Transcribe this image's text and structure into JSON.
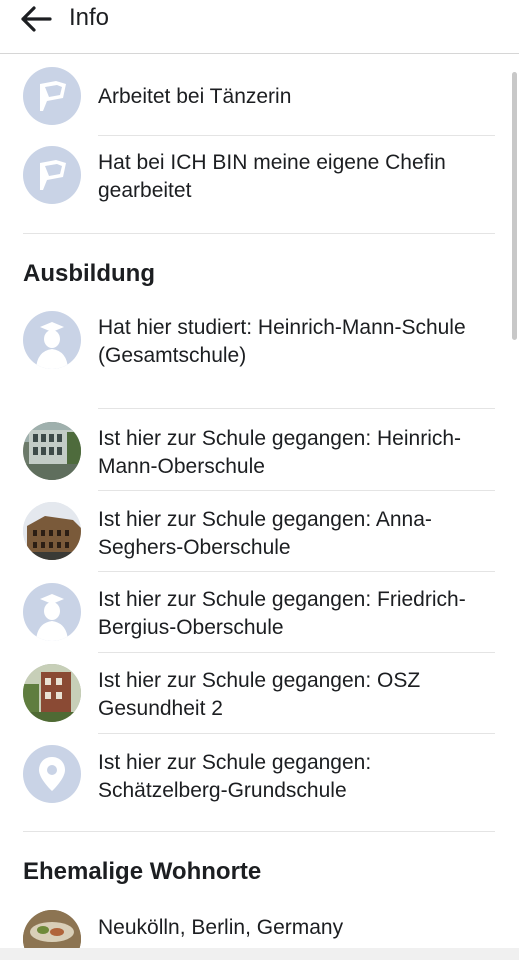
{
  "header": {
    "title": "Info"
  },
  "work": [
    {
      "text": "Arbeitet bei Tänzerin",
      "icon": "briefcase-flag-icon"
    },
    {
      "text": "Hat bei ICH BIN meine eigene Chefin gearbeitet",
      "icon": "briefcase-flag-icon"
    }
  ],
  "education": {
    "title": "Ausbildung",
    "items": [
      {
        "text": "Hat hier studiert: Heinrich-Mann-Schule (Gesamtschule)",
        "icon": "graduate-icon"
      },
      {
        "text": "Ist hier zur Schule gegangen: Heinrich-Mann-Oberschule",
        "icon": "school-photo"
      },
      {
        "text": "Ist hier zur Schule gegangen: Anna-Seghers-Oberschule",
        "icon": "school-photo"
      },
      {
        "text": "Ist hier zur Schule gegangen: Friedrich-Bergius-Oberschule",
        "icon": "graduate-icon"
      },
      {
        "text": "Ist hier zur Schule gegangen: OSZ Gesundheit 2",
        "icon": "school-photo"
      },
      {
        "text": "Ist hier zur Schule gegangen: Schätzelberg-Grundschule",
        "icon": "location-pin-icon"
      }
    ]
  },
  "residences": {
    "title": "Ehemalige Wohnorte",
    "items": [
      {
        "text": "Neukölln, Berlin, Germany",
        "icon": "place-photo"
      }
    ]
  },
  "colors": {
    "icon_bg": "#c9d3e6",
    "text": "#1c1e21",
    "divider": "#e4e4e4"
  }
}
